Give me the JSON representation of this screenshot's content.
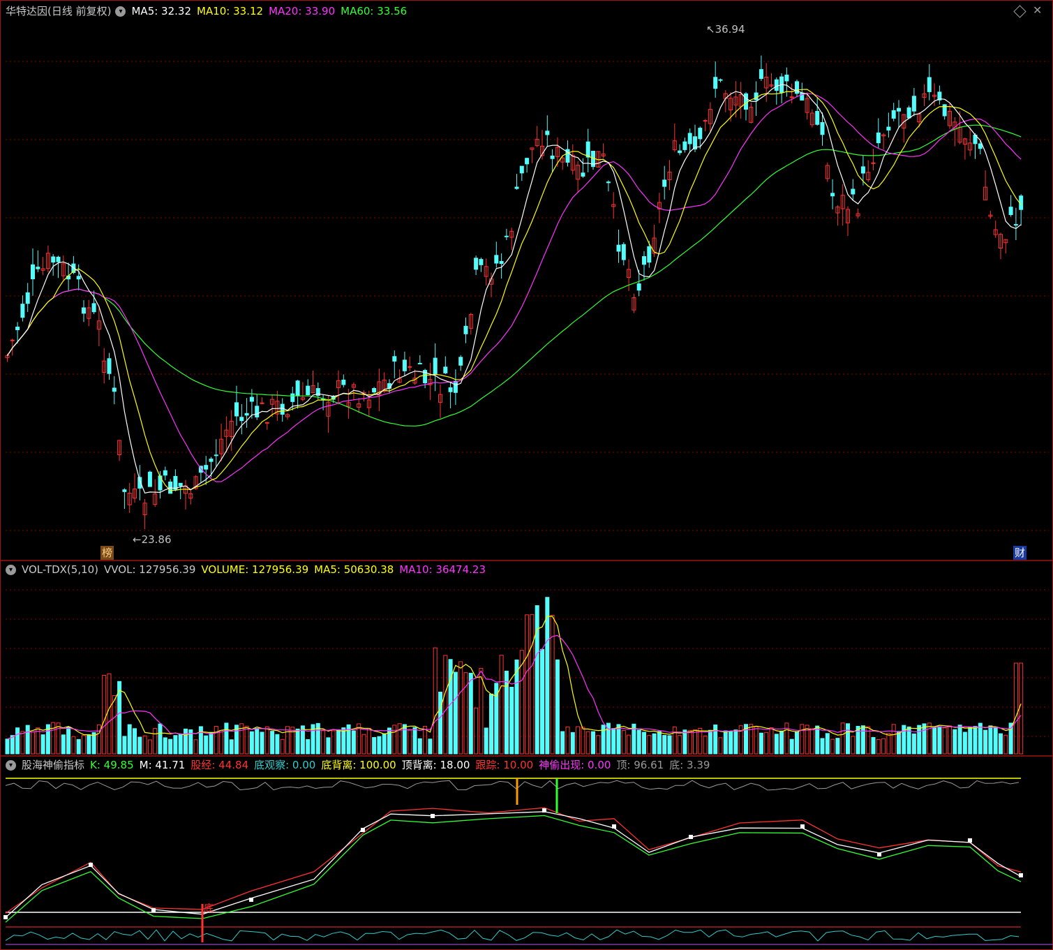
{
  "price_panel": {
    "stock_title": "华特达因(日线 前复权)",
    "ma_labels": [
      {
        "text": "MA5: 32.32",
        "color": "#ffffff"
      },
      {
        "text": "MA10: 33.12",
        "color": "#ffff00"
      },
      {
        "text": "MA20: 33.90",
        "color": "#ff33ff"
      },
      {
        "text": "MA60: 33.56",
        "color": "#33ff33"
      }
    ],
    "high_marker": "36.94",
    "low_marker": "23.86",
    "badge_left": "榜",
    "badge_right": "财",
    "colors": {
      "up": "#ff3232",
      "down": "#54fcfc",
      "ma5": "#ffffff",
      "ma10": "#ffff00",
      "ma20": "#ff33ff",
      "ma60": "#33ff33",
      "grid": "#8b0000"
    }
  },
  "volume_panel": {
    "indicator_name": "VOL-TDX(5,10)",
    "vvol": "VVOL: 127956.39",
    "volume": "VOLUME: 127956.39",
    "ma5": "MA5: 50630.38",
    "ma10": "MA10: 36474.23"
  },
  "indicator_panel": {
    "indicator_name": "股海神偷指标",
    "labels": [
      {
        "text": "K: 49.85",
        "color": "#33ff33"
      },
      {
        "text": "M: 41.71",
        "color": "#ffffff"
      },
      {
        "text": "股经: 44.84",
        "color": "#ff3232"
      },
      {
        "text": "底观察: 0.00",
        "color": "#33cccc"
      },
      {
        "text": "底背离: 100.00",
        "color": "#ffff00"
      },
      {
        "text": "顶背离: 18.00",
        "color": "#ffffff"
      },
      {
        "text": "跟踪: 10.00",
        "color": "#ff3232"
      },
      {
        "text": "神偷出现: 0.00",
        "color": "#ff33ff"
      },
      {
        "text": "顶: 96.61",
        "color": "#9a9a9a"
      },
      {
        "text": "底: 3.39",
        "color": "#9a9a9a"
      }
    ],
    "bottom_signal": "底"
  },
  "icons": {
    "collapse": "chevron-down-icon",
    "diamond": "diamond-icon",
    "close": "close-icon"
  }
}
